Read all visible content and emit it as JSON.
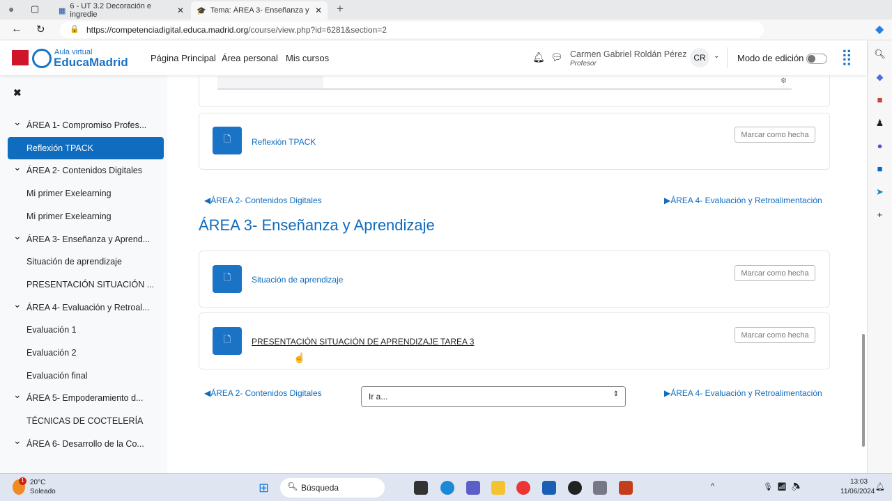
{
  "browser": {
    "tabs": [
      {
        "label": "6 - UT 3.2 Decoración e ingredie"
      },
      {
        "label": "Tema: ÁREA 3- Enseñanza y Apre"
      }
    ],
    "url_host": "https://competenciadigital.educa.madrid.org",
    "url_path": "/course/view.php?id=6281&section=2"
  },
  "header": {
    "logo_small": "Aula virtual",
    "logo_big": "EducaMadrid",
    "nav": [
      "Página Principal",
      "Área personal",
      "Mis cursos"
    ],
    "user_name": "Carmen Gabriel Roldán Pérez",
    "user_role": "Profesor",
    "initials": "CR",
    "edit_mode_label": "Modo de edición",
    "edit_mode_on": false
  },
  "sidebar": {
    "items": [
      {
        "label": "ÁREA 1- Compromiso Profes...",
        "type": "section"
      },
      {
        "label": "Reflexión TPACK",
        "type": "activity",
        "active": true
      },
      {
        "label": "ÁREA 2- Contenidos Digitales",
        "type": "section"
      },
      {
        "label": "Mi primer Exelearning",
        "type": "activity"
      },
      {
        "label": "Mi primer Exelearning",
        "type": "activity"
      },
      {
        "label": "ÁREA 3- Enseñanza y Aprend...",
        "type": "section"
      },
      {
        "label": "Situación de aprendizaje",
        "type": "activity"
      },
      {
        "label": "PRESENTACIÓN SITUACIÓN ...",
        "type": "activity"
      },
      {
        "label": "ÁREA 4- Evaluación y Retroal...",
        "type": "section"
      },
      {
        "label": "Evaluación 1",
        "type": "activity"
      },
      {
        "label": "Evaluación 2",
        "type": "activity"
      },
      {
        "label": "Evaluación final",
        "type": "activity"
      },
      {
        "label": "ÁREA 5- Empoderamiento d...",
        "type": "section"
      },
      {
        "label": "TÉCNICAS DE COCTELERÍA",
        "type": "activity"
      },
      {
        "label": "ÁREA 6- Desarrollo de la Co...",
        "type": "section"
      }
    ]
  },
  "main": {
    "prev_activity": "Reflexión TPACK",
    "mark_label": "Marcar como hecha",
    "prev_section": "◀ÁREA 2- Contenidos Digitales",
    "next_section": "▶ÁREA 4- Evaluación y Retroalimentación",
    "section_title": "ÁREA 3- Enseñanza y Aprendizaje",
    "activities": [
      "Situación de aprendizaje",
      "PRESENTACIÓN SITUACIÓN DE APRENDIZAJE TAREA 3"
    ],
    "jump_placeholder": "Ir a..."
  },
  "taskbar": {
    "temp": "20°C",
    "weather": "Soleado",
    "weather_badge": "1",
    "search": "Búsqueda",
    "time": "13:03",
    "date": "11/06/2024"
  }
}
